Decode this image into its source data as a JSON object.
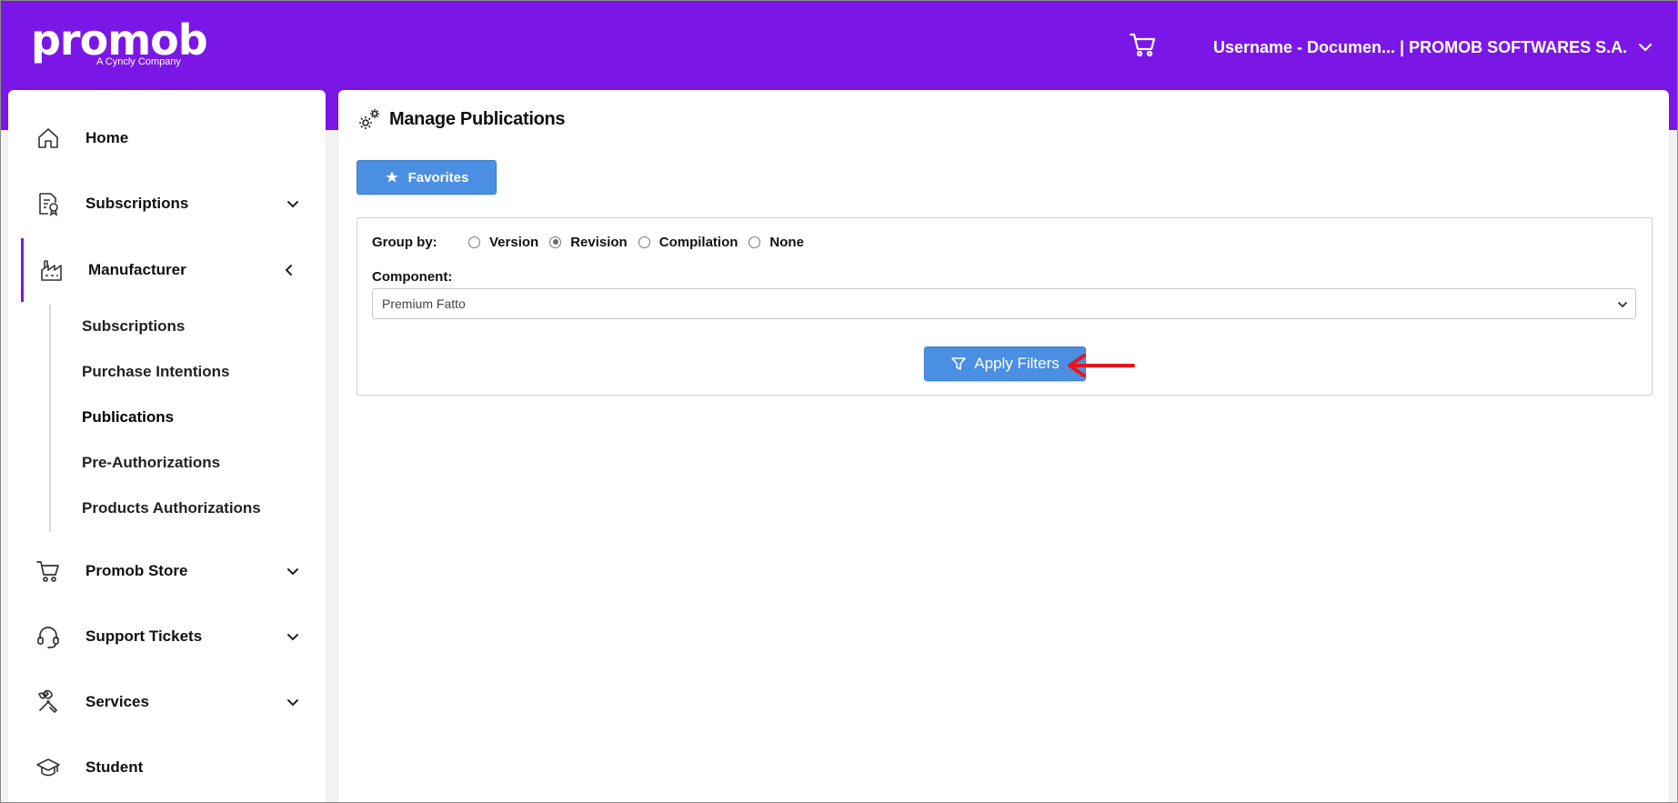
{
  "header": {
    "logo_text": "promob",
    "logo_tagline": "A Cyncly Company",
    "user_label": "Username - Documen... | PROMOB SOFTWARES S.A.",
    "brand_color": "#7a17e6"
  },
  "sidebar": {
    "items": [
      {
        "label": "Home",
        "icon": "home-icon"
      },
      {
        "label": "Subscriptions",
        "icon": "certificate-document-icon"
      },
      {
        "label": "Manufacturer",
        "icon": "factory-icon"
      },
      {
        "label": "Promob Store",
        "icon": "cart-icon"
      },
      {
        "label": "Support Tickets",
        "icon": "headset-icon"
      },
      {
        "label": "Services",
        "icon": "tools-icon"
      },
      {
        "label": "Student",
        "icon": "graduation-cap-icon"
      }
    ],
    "manufacturer_sub": [
      "Subscriptions",
      "Purchase Intentions",
      "Publications",
      "Pre-Authorizations",
      "Products Authorizations"
    ]
  },
  "main": {
    "title": "Manage Publications",
    "favorites_label": "Favorites",
    "group_by_label": "Group by:",
    "group_options": [
      "Version",
      "Revision",
      "Compilation",
      "None"
    ],
    "group_selected": "Revision",
    "component_label": "Component:",
    "component_value": "Premium Fatto",
    "apply_label": "Apply Filters",
    "button_color": "#4a8fe2"
  }
}
